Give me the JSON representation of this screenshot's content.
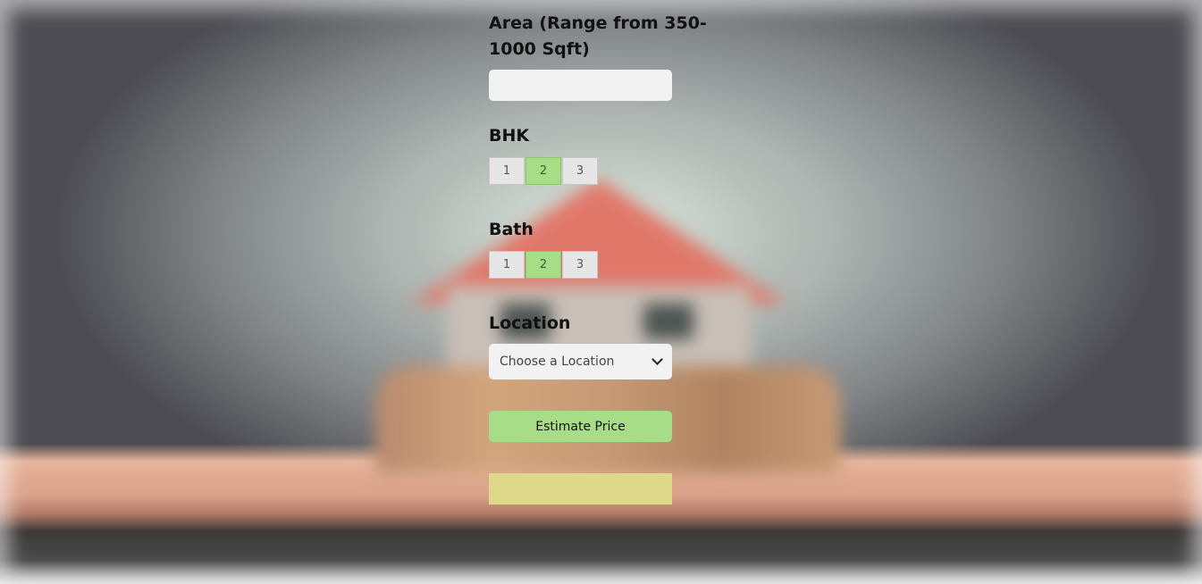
{
  "form": {
    "area_label": "Area (Range from 350-1000 Sqft)",
    "area_value": "",
    "bhk_label": "BHK",
    "bhk_options": [
      "1",
      "2",
      "3"
    ],
    "bhk_selected": "2",
    "bath_label": "Bath",
    "bath_options": [
      "1",
      "2",
      "3"
    ],
    "bath_selected": "2",
    "location_label": "Location",
    "location_selected": "Choose a Location",
    "estimate_button": "Estimate Price",
    "result_text": ""
  },
  "colors": {
    "accent_green": "#a8dd88",
    "result_yellow": "#ddd88a",
    "input_bg": "#f2f2f2"
  },
  "icons": {
    "select_arrow": "chevron-down-icon"
  }
}
